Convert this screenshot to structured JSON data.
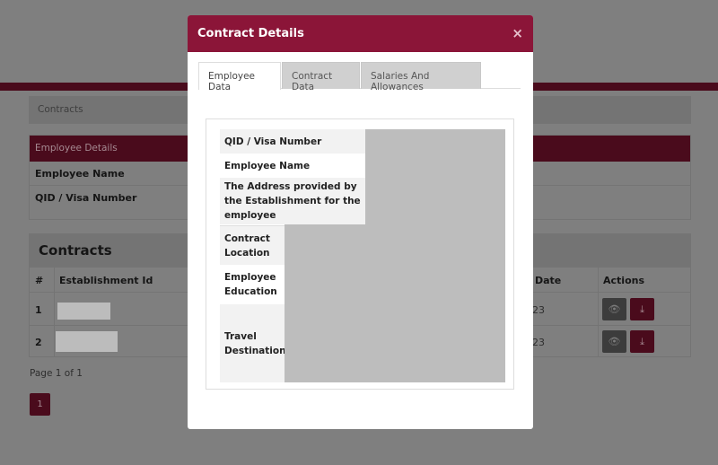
{
  "breadcrumb": "Contracts",
  "employee_details": {
    "title": "Employee Details",
    "rows": [
      "Employee Name",
      "QID / Visa Number"
    ]
  },
  "contracts": {
    "title": "Contracts",
    "columns": [
      "#",
      "Establishment Id",
      "Date",
      "Actions"
    ],
    "rows": [
      {
        "num": "1",
        "date": "23"
      },
      {
        "num": "2",
        "date": "23"
      }
    ],
    "page_info": "Page 1 of 1",
    "page": "1"
  },
  "modal": {
    "title": "Contract Details",
    "close": "×",
    "tabs": [
      {
        "label": "Employee Data",
        "active": true
      },
      {
        "label": "Contract Data",
        "active": false
      },
      {
        "label": "Salaries And Allowances",
        "active": false
      }
    ],
    "fields": [
      "QID / Visa Number",
      "Employee Name",
      "The Address provided by the Establishment for the employee",
      "Contract Location",
      "Employee Education",
      "Travel Destination"
    ]
  },
  "colors": {
    "brand": "#8b1538"
  }
}
